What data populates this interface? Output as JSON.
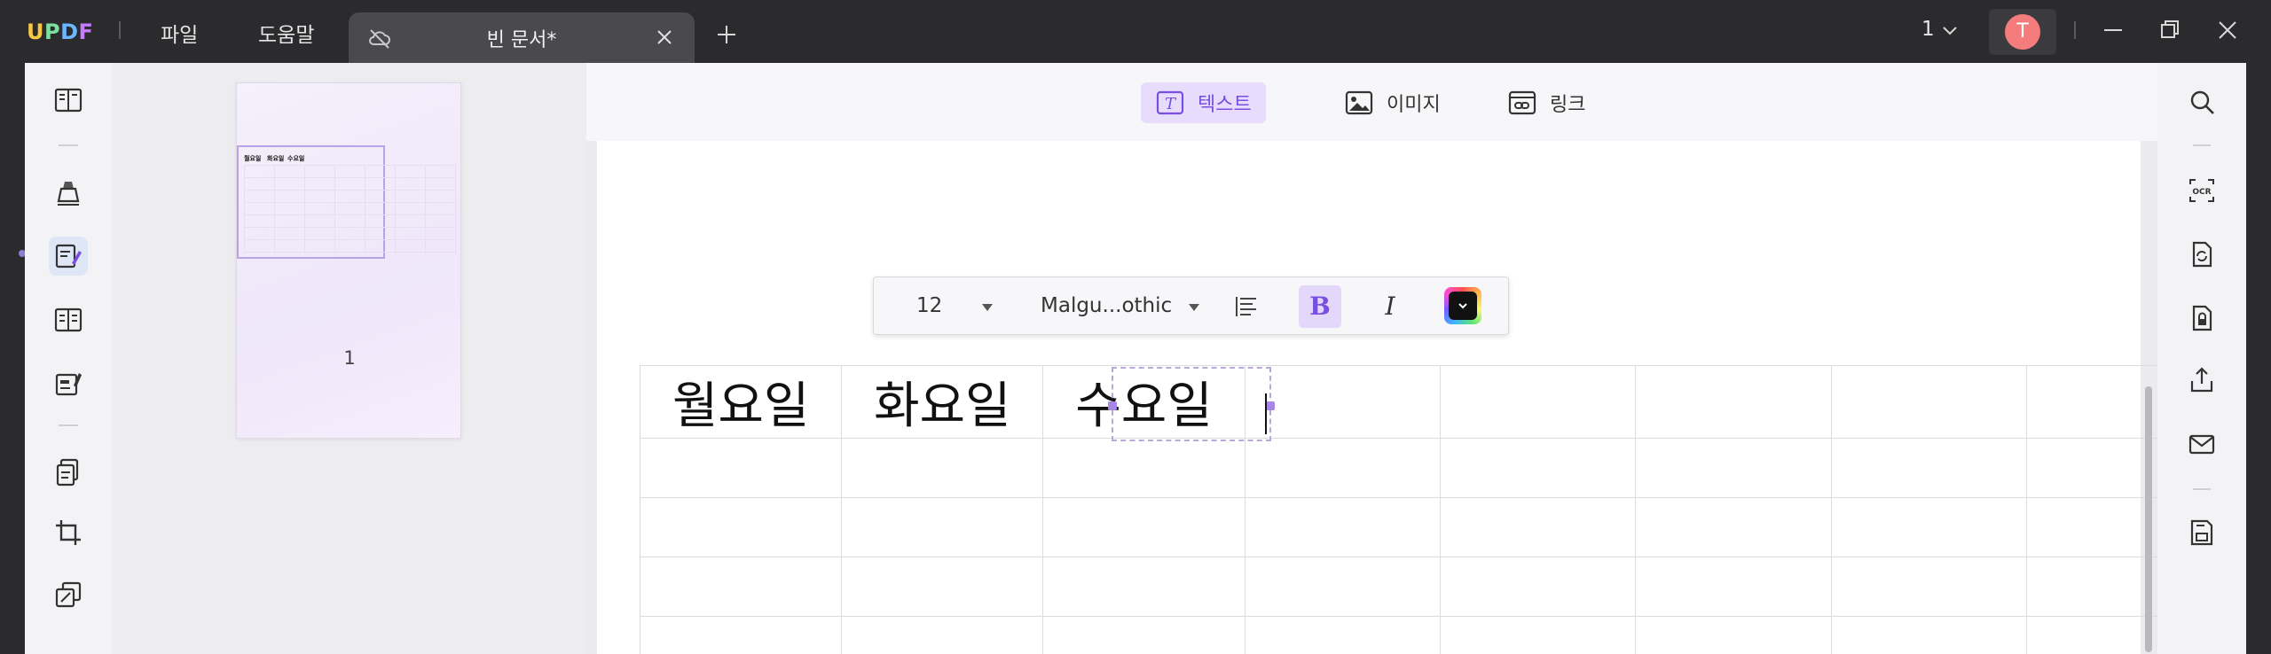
{
  "app": {
    "logo": [
      "U",
      "P",
      "D",
      "F"
    ]
  },
  "menu": {
    "file": "파일",
    "help": "도움말"
  },
  "tab": {
    "title": "빈 문서*"
  },
  "header": {
    "page_indicator": "1",
    "avatar_initial": "T"
  },
  "editor_modes": [
    {
      "label": "텍스트",
      "icon": "text-tool-icon",
      "active": true
    },
    {
      "label": "이미지",
      "icon": "image-tool-icon",
      "active": false
    },
    {
      "label": "링크",
      "icon": "link-tool-icon",
      "active": false
    }
  ],
  "format_bar": {
    "font_size": "12",
    "font_name": "Malgu...othic",
    "bold_label": "B",
    "italic_label": "I",
    "bold_active": true,
    "text_color": "#111111"
  },
  "thumbnails": {
    "page_label": "1",
    "preview_words": [
      "월요일",
      "화요일",
      "수요일"
    ]
  },
  "table": {
    "headers": [
      "월요일",
      "화요일",
      "수요일",
      "",
      "",
      "",
      "",
      ""
    ],
    "row_count": 5,
    "selected_cell_index": 2
  },
  "colors": {
    "accent": "#7a4fe0",
    "accent_light": "#e7dcfb",
    "titlebar_bg": "#2b2b2e",
    "avatar_bg": "#f47c7c"
  },
  "left_tools": [
    "reader-mode-icon",
    "comment-highlighter-icon",
    "edit-pdf-icon",
    "organize-pages-icon",
    "form-fill-icon",
    "page-tools-icon",
    "crop-icon",
    "layers-icon"
  ],
  "right_tools": [
    "search-icon",
    "ocr-icon",
    "convert-icon",
    "protect-icon",
    "share-icon",
    "mail-icon",
    "save-icon"
  ]
}
